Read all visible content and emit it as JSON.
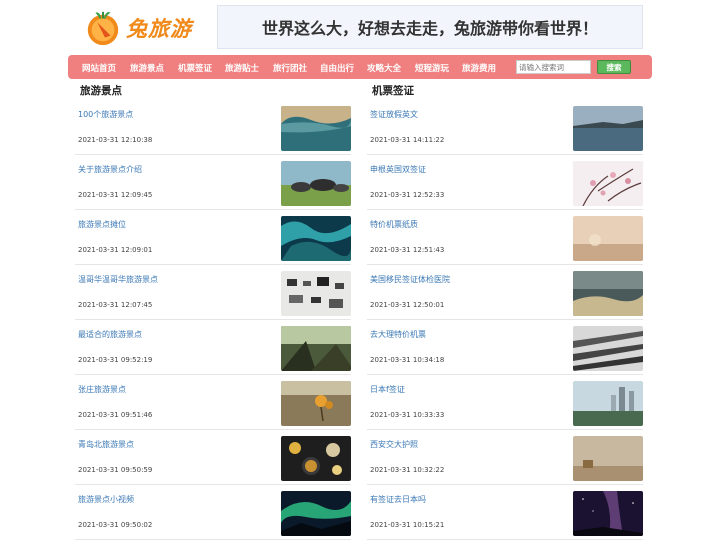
{
  "logo": {
    "text": "兔旅游"
  },
  "banner": {
    "text": "世界这么大，好想去走走，兔旅游带你看世界！"
  },
  "nav": {
    "items": [
      "网站首页",
      "旅游景点",
      "机票签证",
      "旅游贴士",
      "旅行团社",
      "自由出行",
      "攻略大全",
      "短程游玩",
      "旅游费用"
    ],
    "search_placeholder": "请输入搜索词",
    "search_button": "搜索"
  },
  "left": {
    "title": "旅游景点",
    "items": [
      {
        "title": "100个旅游景点",
        "time": "2021-03-31 12:10:38"
      },
      {
        "title": "关于旅游景点介绍",
        "time": "2021-03-31 12:09:45"
      },
      {
        "title": "旅游景点摊位",
        "time": "2021-03-31 12:09:01"
      },
      {
        "title": "温哥华温哥华旅游景点",
        "time": "2021-03-31 12:07:45"
      },
      {
        "title": "最适合的旅游景点",
        "time": "2021-03-31 09:52:19"
      },
      {
        "title": "张庄旅游景点",
        "time": "2021-03-31 09:51:46"
      },
      {
        "title": "青岛北旅游景点",
        "time": "2021-03-31 09:50:59"
      },
      {
        "title": "旅游景点小视频",
        "time": "2021-03-31 09:50:02"
      }
    ]
  },
  "right": {
    "title": "机票签证",
    "items": [
      {
        "title": "签证放假英文",
        "time": "2021-03-31 14:11:22"
      },
      {
        "title": "申根英国双签证",
        "time": "2021-03-31 12:52:33"
      },
      {
        "title": "特价机票纸质",
        "time": "2021-03-31 12:51:43"
      },
      {
        "title": "美国移民签证体检医院",
        "time": "2021-03-31 12:50:01"
      },
      {
        "title": "去大理特价机票",
        "time": "2021-03-31 10:34:18"
      },
      {
        "title": "日本f签证",
        "time": "2021-03-31 10:33:33"
      },
      {
        "title": "西安交大护照",
        "time": "2021-03-31 10:32:22"
      },
      {
        "title": "有签证去日本吗",
        "time": "2021-03-31 10:15:21"
      }
    ]
  },
  "colors": {
    "nav": "#f07f7f",
    "link": "#3b78b5",
    "button": "#5cb85c",
    "logo": "#f08a1a"
  }
}
